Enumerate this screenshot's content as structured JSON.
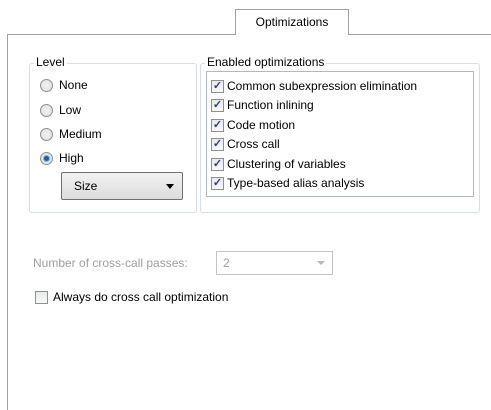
{
  "tab": {
    "label": "Optimizations"
  },
  "level": {
    "legend": "Level",
    "options": [
      "None",
      "Low",
      "Medium",
      "High"
    ],
    "selected": "High",
    "dropdown_value": "Size"
  },
  "enabled": {
    "legend": "Enabled optimizations",
    "items": [
      {
        "label": "Common subexpression elimination",
        "checked": true
      },
      {
        "label": "Function inlining",
        "checked": true
      },
      {
        "label": "Code motion",
        "checked": true
      },
      {
        "label": "Cross call",
        "checked": true
      },
      {
        "label": "Clustering of variables",
        "checked": true
      },
      {
        "label": "Type-based alias analysis",
        "checked": true
      }
    ]
  },
  "cross_call": {
    "passes_label": "Number of cross-call passes:",
    "passes_value": "2",
    "always_label": "Always do cross call optimization",
    "always_checked": false
  }
}
